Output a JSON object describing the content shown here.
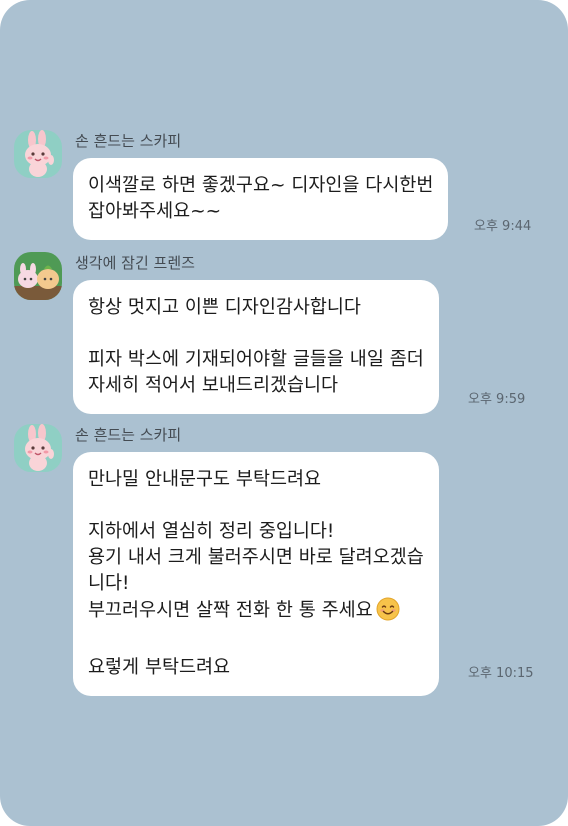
{
  "messages": [
    {
      "sender": "손 흔드는 스카피",
      "avatar_icon": "rabbit-waving-icon",
      "lines": [
        "이색깔로 하면 좋겠구요~ 디자인을 다시한번",
        "잡아봐주세요~~"
      ],
      "time": "오후 9:44"
    },
    {
      "sender": "생각에 잠긴 프렌즈",
      "avatar_icon": "friends-thinking-icon",
      "lines": [
        "항상 멋지고 이쁜 디자인감사합니다",
        "",
        "피자 박스에 기재되어야할 글들을 내일 좀더",
        "자세히 적어서 보내드리겠습니다"
      ],
      "time": "오후 9:59"
    },
    {
      "sender": "손 흔드는 스카피",
      "avatar_icon": "rabbit-waving-icon",
      "lines": [
        "만나밀 안내문구도 부탁드려요",
        "",
        "지하에서 열심히 정리 중입니다!",
        "용기 내서 크게 불러주시면 바로 달려오겠습",
        "니다!",
        "부끄러우시면 살짝 전화 한 통 주세요",
        "",
        "요렇게 부탁드려요"
      ],
      "emoji_icon": "smiling-face-emoji-icon",
      "time": "오후 10:15"
    }
  ],
  "colors": {
    "background": "#abc1d1",
    "bubble": "#ffffff",
    "rabbit_avatar_bg": "#8fcfc4",
    "friends_avatar_bg": "#4f9a55"
  }
}
